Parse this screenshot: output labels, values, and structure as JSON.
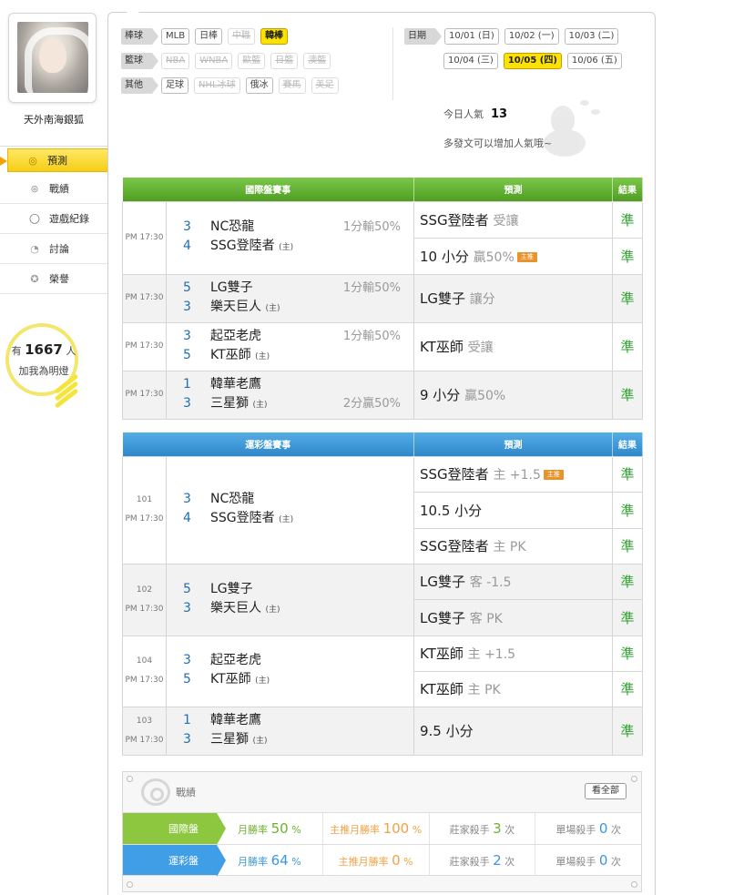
{
  "user": {
    "name": "天外南海銀狐"
  },
  "nav": [
    {
      "label": "預測",
      "icon": "target-icon",
      "active": true
    },
    {
      "label": "戰績",
      "icon": "record-icon"
    },
    {
      "label": "遊戲紀錄",
      "icon": "circle-icon"
    },
    {
      "label": "討論",
      "icon": "chat-icon"
    },
    {
      "label": "榮譽",
      "icon": "medal-icon"
    }
  ],
  "fans": {
    "prefix": "有",
    "count": "1667",
    "suffix": "人",
    "cta": "加我為明燈"
  },
  "filters": {
    "baseball": {
      "label": "棒球",
      "tags": [
        "MLB",
        "日棒",
        "中職",
        "韓棒"
      ]
    },
    "basketball": {
      "label": "籃球",
      "tags": [
        "NBA",
        "WNBA",
        "歐籃",
        "日籃",
        "澳籃"
      ]
    },
    "other": {
      "label": "其他",
      "tags": [
        "足球",
        "NHL冰球",
        "俄冰",
        "賽馬",
        "美足"
      ]
    }
  },
  "dates": {
    "label": "日期",
    "items": [
      "10/01 (日)",
      "10/02 (一)",
      "10/03 (二)",
      "10/04 (三)",
      "10/05 (四)",
      "10/06 (五)"
    ]
  },
  "popularity": {
    "label": "今日人氣",
    "value": "13",
    "hint": "多發文可以增加人氣哦~"
  },
  "intl": {
    "headers": [
      "國際盤賽事",
      "預測",
      "結果"
    ],
    "games": [
      {
        "time": "PM 17:30",
        "t1": {
          "num": "3",
          "name": "NC恐龍",
          "hc": "1分輸50%"
        },
        "t2": {
          "num": "4",
          "name": "SSG登陸者",
          "home": "(主)",
          "hc": ""
        },
        "p1": {
          "main": "SSG登陸者",
          "sub": "受讓",
          "res": "準"
        },
        "p2": {
          "main": "10 小分",
          "sub": "贏50%",
          "badge": "主推",
          "res": "準"
        }
      },
      {
        "time": "PM 17:30",
        "t1": {
          "num": "5",
          "name": "LG雙子",
          "hc": "1分輸50%"
        },
        "t2": {
          "num": "3",
          "name": "樂天巨人",
          "home": "(主)",
          "hc": ""
        },
        "p1": {
          "main": "LG雙子",
          "sub": "讓分",
          "res": "準"
        }
      },
      {
        "time": "PM 17:30",
        "t1": {
          "num": "3",
          "name": "起亞老虎",
          "hc": "1分輸50%"
        },
        "t2": {
          "num": "5",
          "name": "KT巫師",
          "home": "(主)",
          "hc": ""
        },
        "p1": {
          "main": "KT巫師",
          "sub": "受讓",
          "res": "準"
        }
      },
      {
        "time": "PM 17:30",
        "t1": {
          "num": "1",
          "name": "韓華老鷹",
          "hc": ""
        },
        "t2": {
          "num": "3",
          "name": "三星獅",
          "home": "(主)",
          "hc": "2分贏50%"
        },
        "p1": {
          "main": "9 小分",
          "sub": "贏50%",
          "res": "準"
        }
      }
    ]
  },
  "lottery": {
    "headers": [
      "運彩盤賽事",
      "預測",
      "結果"
    ],
    "games": [
      {
        "no": "101",
        "time": "PM 17:30",
        "t1": {
          "num": "3",
          "name": "NC恐龍"
        },
        "t2": {
          "num": "4",
          "name": "SSG登陸者",
          "home": "(主)"
        },
        "preds": [
          {
            "main": "SSG登陸者",
            "sub": "主 +1.5",
            "badge": "主推",
            "res": "準"
          },
          {
            "main": "10.5 小分",
            "sub": "",
            "res": "準"
          },
          {
            "main": "SSG登陸者",
            "sub": "主 PK",
            "res": "準"
          }
        ]
      },
      {
        "no": "102",
        "time": "PM 17:30",
        "t1": {
          "num": "5",
          "name": "LG雙子"
        },
        "t2": {
          "num": "3",
          "name": "樂天巨人",
          "home": "(主)"
        },
        "preds": [
          {
            "main": "LG雙子",
            "sub": "客 -1.5",
            "res": "準"
          },
          {
            "main": "LG雙子",
            "sub": "客 PK",
            "res": "準"
          }
        ]
      },
      {
        "no": "104",
        "time": "PM 17:30",
        "t1": {
          "num": "3",
          "name": "起亞老虎"
        },
        "t2": {
          "num": "5",
          "name": "KT巫師",
          "home": "(主)"
        },
        "preds": [
          {
            "main": "KT巫師",
            "sub": "主 +1.5",
            "res": "準"
          },
          {
            "main": "KT巫師",
            "sub": "主 PK",
            "res": "準"
          }
        ]
      },
      {
        "no": "103",
        "time": "PM 17:30",
        "t1": {
          "num": "1",
          "name": "韓華老鷹"
        },
        "t2": {
          "num": "3",
          "name": "三星獅",
          "home": "(主)"
        },
        "preds": [
          {
            "main": "9.5 小分",
            "sub": "",
            "res": "準"
          }
        ]
      }
    ]
  },
  "record": {
    "title": "戰績",
    "view_all": "看全部",
    "rows": [
      {
        "name": "國際盤",
        "win_label": "月勝率",
        "win": "50",
        "top_label": "主推月勝率",
        "top": "100",
        "pct": "%",
        "kill_label": "莊家殺手",
        "kill": "3",
        "single_label": "單場殺手",
        "single": "0",
        "unit": "次"
      },
      {
        "name": "運彩盤",
        "win_label": "月勝率",
        "win": "64",
        "top_label": "主推月勝率",
        "top": "0",
        "pct": "%",
        "kill_label": "莊家殺手",
        "kill": "2",
        "single_label": "單場殺手",
        "single": "0",
        "unit": "次"
      }
    ]
  }
}
